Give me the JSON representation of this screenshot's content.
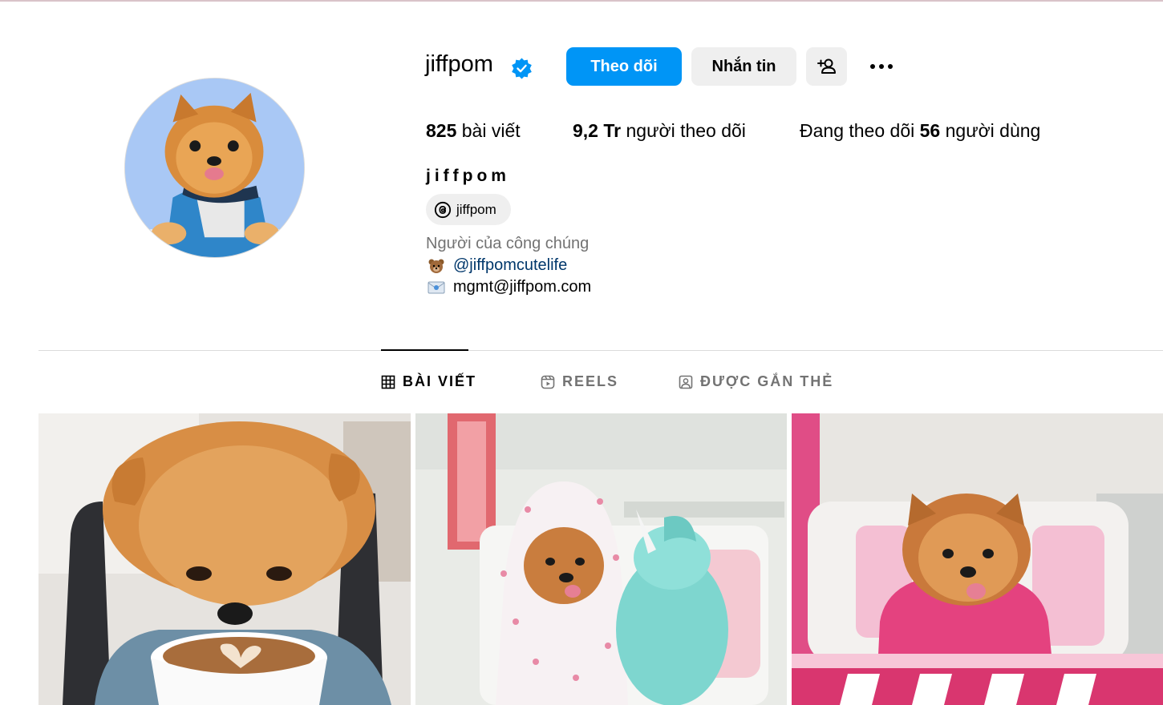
{
  "profile": {
    "username": "jiffpom",
    "full_name": "jiffpom",
    "threads_handle": "jiffpom",
    "category": "Người của công chúng",
    "bio_mention": "@jiffpomcutelife",
    "bio_email": "mgmt@jiffpom.com",
    "verified": true
  },
  "actions": {
    "follow_label": "Theo dõi",
    "message_label": "Nhắn tin",
    "add_user_icon": "add-user-icon",
    "more_icon": "more-options-icon"
  },
  "stats": {
    "posts_count": "825",
    "posts_label": "bài viết",
    "followers_count": "9,2 Tr",
    "followers_label": "người theo dõi",
    "following_prefix": "Đang theo dõi",
    "following_count": "56",
    "following_suffix": "người dùng"
  },
  "tabs": [
    {
      "label": "BÀI VIẾT",
      "icon": "grid-icon",
      "active": true
    },
    {
      "label": "REELS",
      "icon": "reels-icon",
      "active": false
    },
    {
      "label": "ĐƯỢC GẮN THẺ",
      "icon": "tagged-icon",
      "active": false
    }
  ],
  "colors": {
    "accent": "#0095f6",
    "button_secondary": "#efefef",
    "muted_text": "#737373",
    "link": "#00376b"
  }
}
